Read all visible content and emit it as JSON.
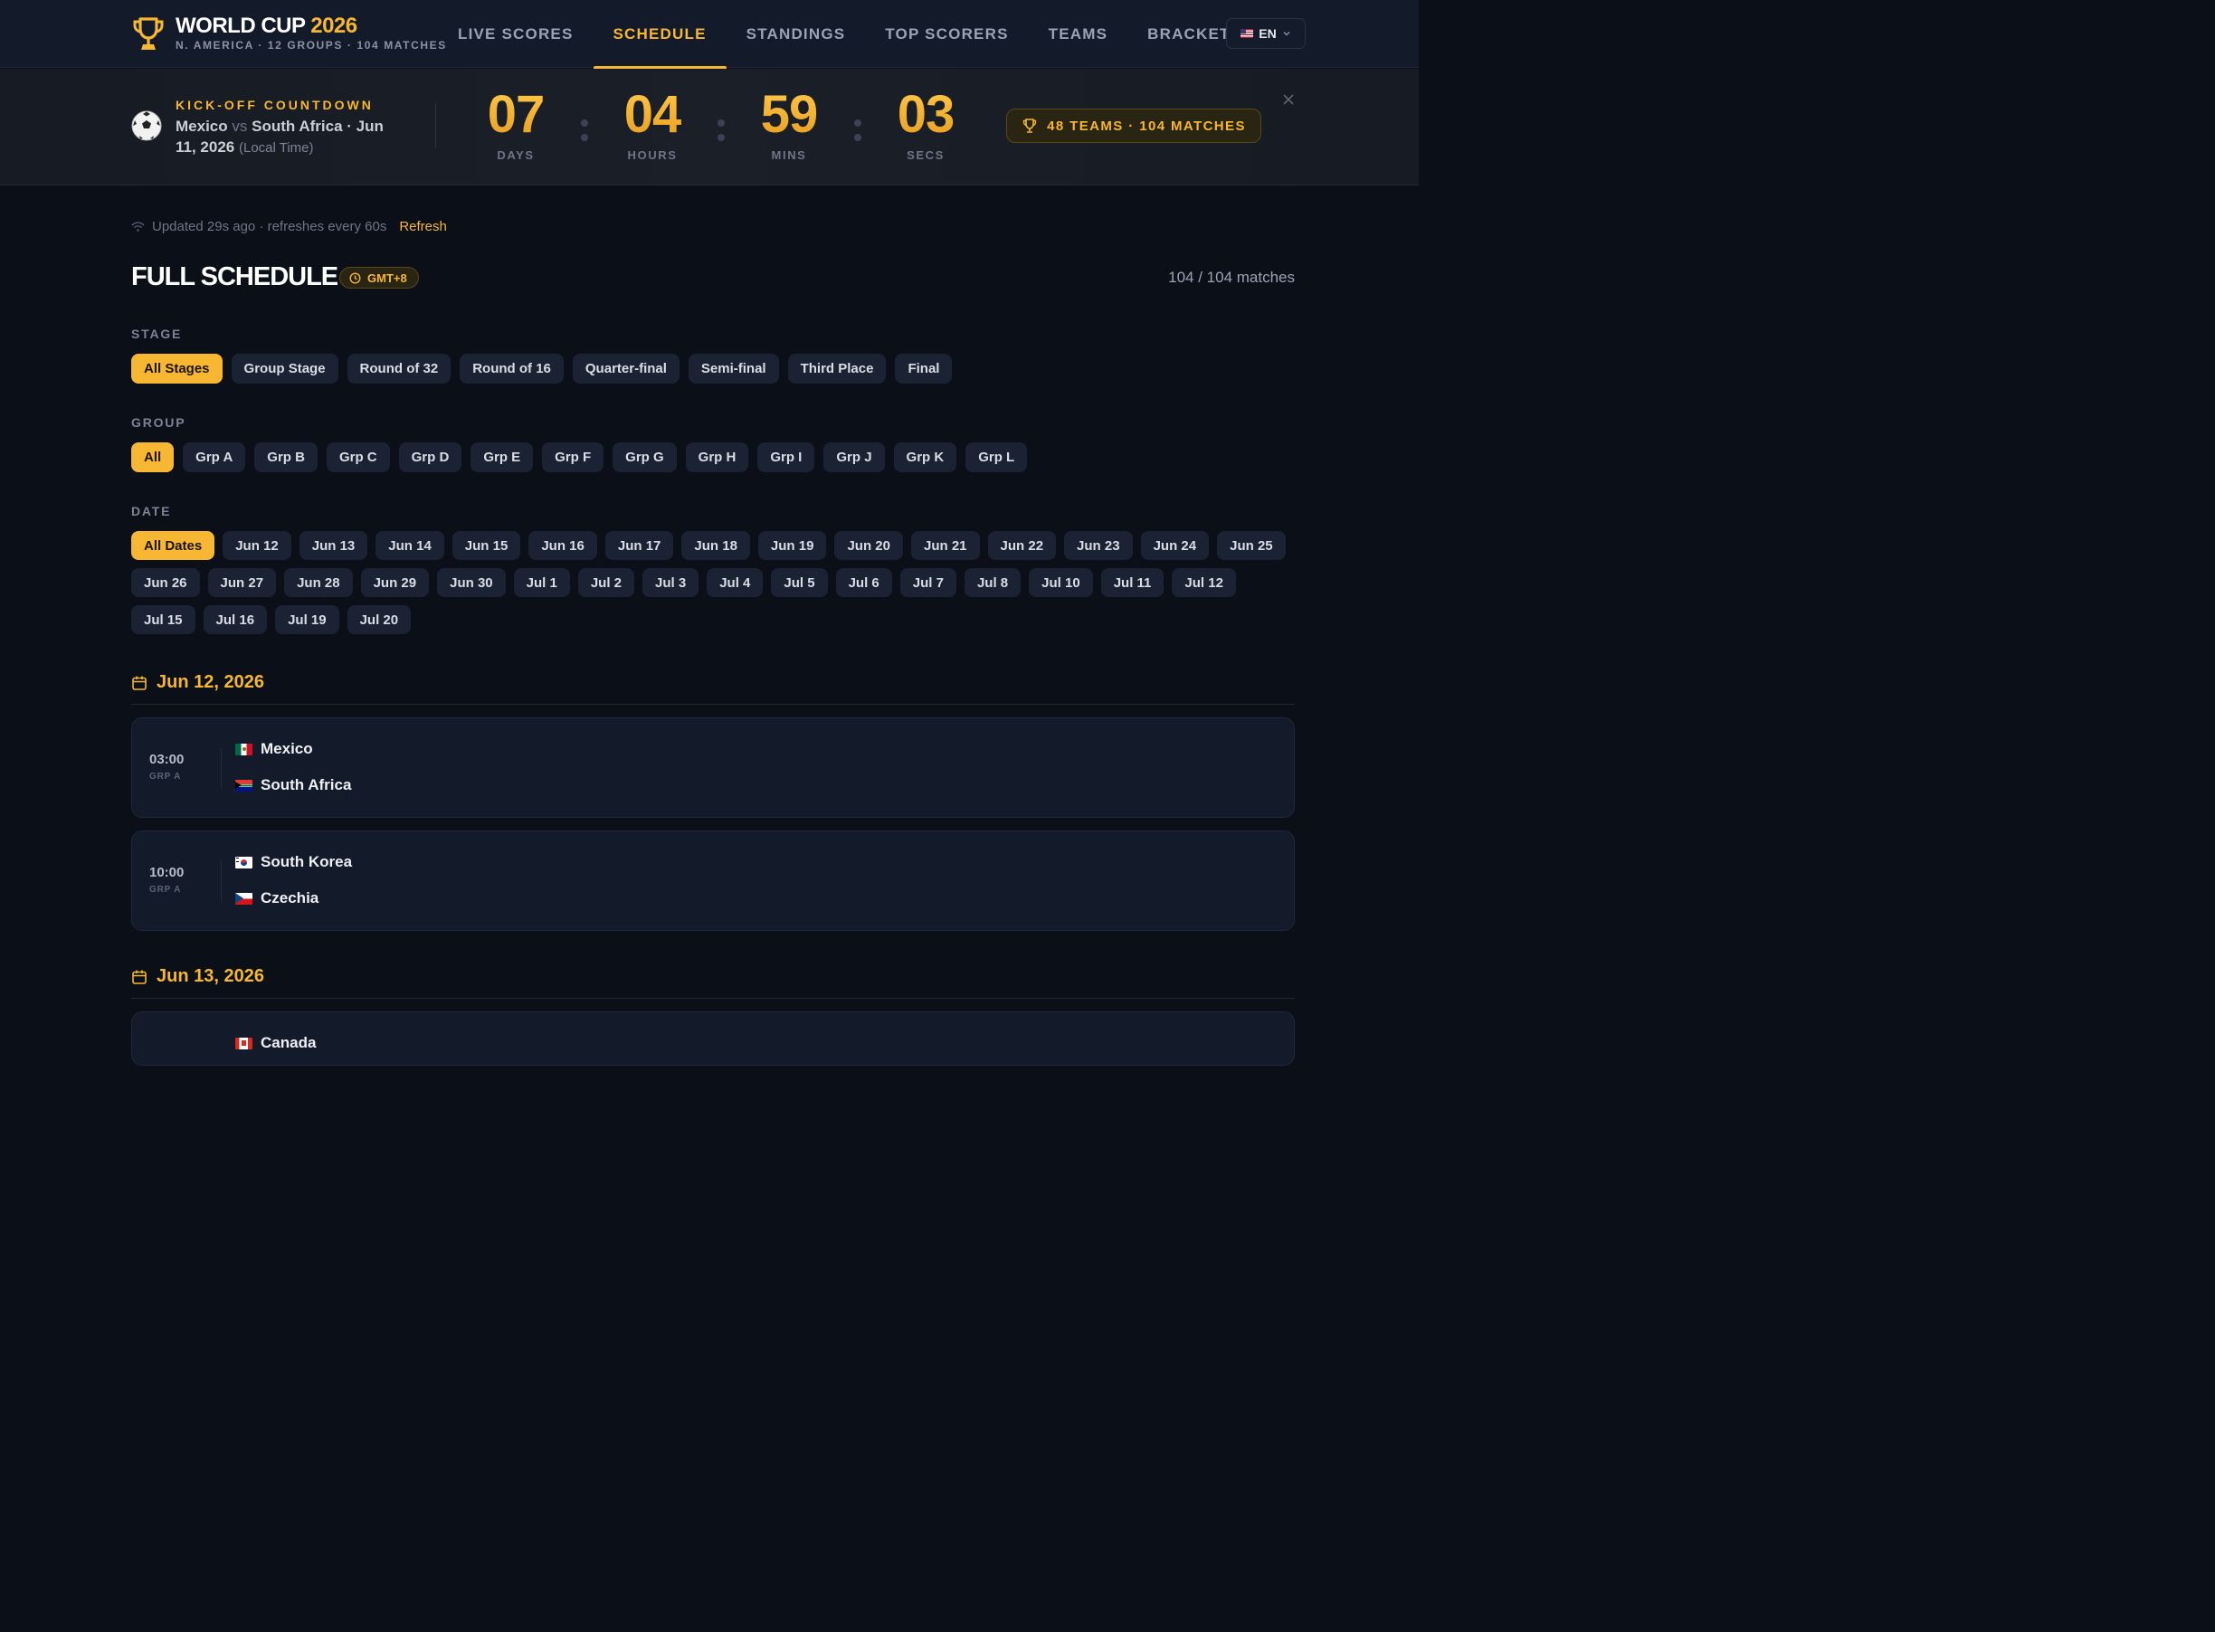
{
  "brand": {
    "title_main": "WORLD CUP",
    "title_year": "2026",
    "subtitle": "N. AMERICA · 12 GROUPS · 104 MATCHES"
  },
  "nav": {
    "links": [
      "LIVE SCORES",
      "SCHEDULE",
      "STANDINGS",
      "TOP SCORERS",
      "TEAMS",
      "BRACKET"
    ],
    "active": "SCHEDULE",
    "lang": "EN"
  },
  "countdown": {
    "label": "KICK-OFF COUNTDOWN",
    "home": "Mexico",
    "vs": "vs",
    "away": "South Africa",
    "date": "· Jun 11, 2026",
    "local": "(Local Time)",
    "days": "07",
    "hours": "04",
    "mins": "59",
    "secs": "03",
    "days_label": "DAYS",
    "hours_label": "HOURS",
    "mins_label": "MINS",
    "secs_label": "SECS",
    "badge": "48 TEAMS · 104 MATCHES"
  },
  "status": {
    "updated": "Updated 29s ago · refreshes every 60s",
    "refresh": "Refresh"
  },
  "schedule": {
    "title": "FULL SCHEDULE",
    "timezone": "GMT+8",
    "count": "104 / 104 matches"
  },
  "filters": {
    "stage_label": "STAGE",
    "stages": [
      "All Stages",
      "Group Stage",
      "Round of 32",
      "Round of 16",
      "Quarter-final",
      "Semi-final",
      "Third Place",
      "Final"
    ],
    "group_label": "GROUP",
    "groups": [
      "All",
      "Grp A",
      "Grp B",
      "Grp C",
      "Grp D",
      "Grp E",
      "Grp F",
      "Grp G",
      "Grp H",
      "Grp I",
      "Grp J",
      "Grp K",
      "Grp L"
    ],
    "date_label": "DATE",
    "dates": [
      "All Dates",
      "Jun 12",
      "Jun 13",
      "Jun 14",
      "Jun 15",
      "Jun 16",
      "Jun 17",
      "Jun 18",
      "Jun 19",
      "Jun 20",
      "Jun 21",
      "Jun 22",
      "Jun 23",
      "Jun 24",
      "Jun 25",
      "Jun 26",
      "Jun 27",
      "Jun 28",
      "Jun 29",
      "Jun 30",
      "Jul 1",
      "Jul 2",
      "Jul 3",
      "Jul 4",
      "Jul 5",
      "Jul 6",
      "Jul 7",
      "Jul 8",
      "Jul 10",
      "Jul 11",
      "Jul 12",
      "Jul 15",
      "Jul 16",
      "Jul 19",
      "Jul 20"
    ]
  },
  "days": [
    {
      "date": "Jun 12, 2026",
      "matches": [
        {
          "time": "03:00",
          "group": "GRP A",
          "home": "Mexico",
          "home_flag": "mx",
          "away": "South Africa",
          "away_flag": "za"
        },
        {
          "time": "10:00",
          "group": "GRP A",
          "home": "South Korea",
          "home_flag": "kr",
          "away": "Czechia",
          "away_flag": "cz"
        }
      ]
    },
    {
      "date": "Jun 13, 2026",
      "matches": [
        {
          "time": "",
          "group": "",
          "home": "Canada",
          "home_flag": "ca",
          "away": "",
          "away_flag": ""
        }
      ]
    }
  ],
  "colors": {
    "accent": "#f7b733",
    "background": "#0b0f17",
    "card": "#131a29"
  },
  "icons": [
    "trophy-icon",
    "soccer-ball-icon",
    "close-icon",
    "wifi-icon",
    "clock-icon",
    "calendar-icon",
    "chevron-down-icon"
  ]
}
